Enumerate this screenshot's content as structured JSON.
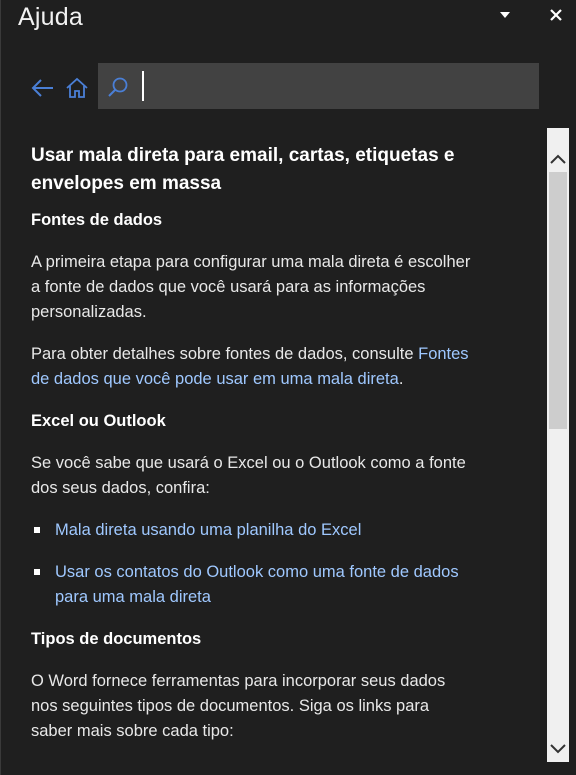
{
  "pane": {
    "title": "Ajuda",
    "menu_icon": "caret-down-icon",
    "close_icon": "close-icon"
  },
  "nav": {
    "back_icon": "back-arrow-icon",
    "home_icon": "home-icon",
    "search_icon": "search-icon",
    "search_value": "",
    "search_placeholder": ""
  },
  "article": {
    "title": "Usar mala direta para email, cartas, etiquetas e envelopes em massa",
    "section1_heading": "Fontes de dados",
    "section1_p1": "A primeira etapa para configurar uma mala direta é escolher a fonte de dados que você usará para as informações personalizadas.",
    "section1_p2_text": "Para obter detalhes sobre fontes de dados, consulte",
    "section1_p2_link": "Fontes de dados que você pode usar em uma mala direta",
    "section1_p2_end": ".",
    "section2_heading": "Excel ou Outlook",
    "section2_p1": "Se você sabe que usará o Excel ou o Outlook como a fonte dos seus dados, confira:",
    "section2_links": [
      "Mala direta usando uma planilha do Excel",
      "Usar os contatos do Outlook como uma fonte de dados para uma mala direta"
    ],
    "section3_heading": "Tipos de documentos",
    "section3_p1": "O Word fornece ferramentas para incorporar seus dados nos seguintes tipos de documentos. Siga os links para saber mais sobre cada tipo:"
  },
  "colors": {
    "background": "#1f1f1f",
    "link": "#9fc8ff",
    "accent_icon": "#4a7fd6",
    "search_box": "#424242"
  }
}
